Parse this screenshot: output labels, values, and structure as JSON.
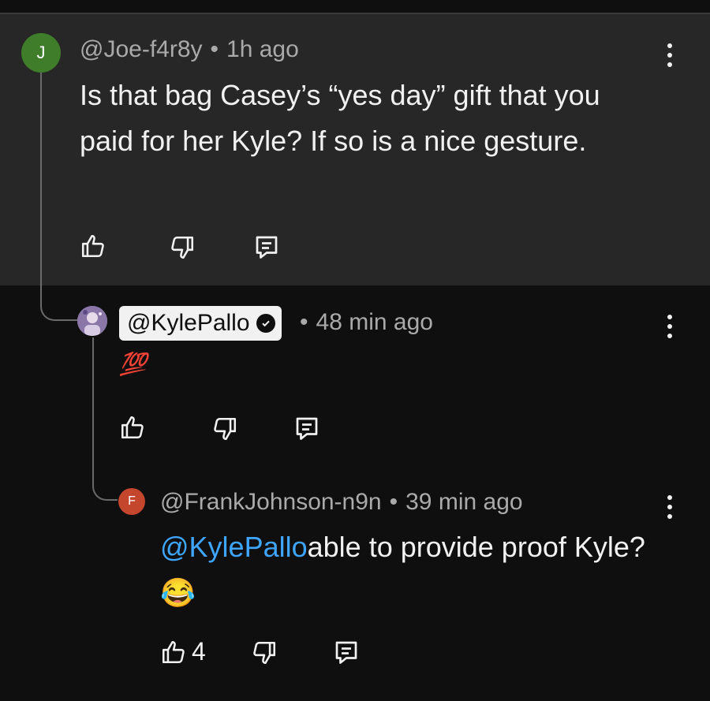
{
  "comments": [
    {
      "avatar_letter": "J",
      "avatar_color": "#3f7d2a",
      "author": "@Joe-f4r8y",
      "time": "1h ago",
      "text": "Is that bag Casey’s “yes day” gift that you paid for her Kyle? If so is a nice gesture.",
      "likes": ""
    },
    {
      "avatar_letter": "",
      "author": "@KylePallo",
      "time": "48 min ago",
      "text": "💯",
      "likes": ""
    },
    {
      "avatar_letter": "F",
      "avatar_color": "#c4462c",
      "author": "@FrankJohnson-n9n",
      "time": "39 min ago",
      "mention": "@KylePallo",
      "text": "able to provide proof Kyle? 😂",
      "likes": "4"
    }
  ],
  "separator": "•"
}
